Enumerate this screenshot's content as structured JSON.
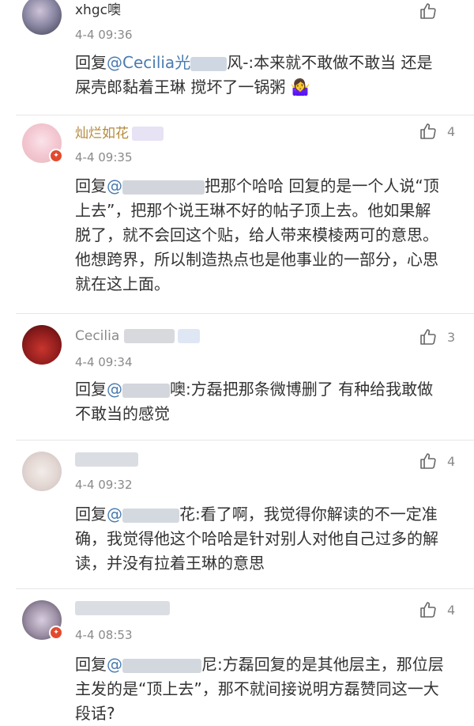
{
  "comments": [
    {
      "user": "xhgc噢",
      "time": "4-4 09:36",
      "likes": "",
      "reply_prefix": "回复",
      "mention": "@Cecilia光",
      "mention_suffix": "风-:",
      "text": "本来就不敢做不敢当 还是屎壳郎黏着王琳 搅坏了一锅粥 🤷‍♀️"
    },
    {
      "user": "灿烂如花",
      "time": "4-4 09:35",
      "likes": "4",
      "reply_prefix": "回复",
      "mention": "@",
      "mention_suffix": "把",
      "text": "那个哈哈 回复的是一个人说“顶上去”，把那个说王琳不好的帖子顶上去。他如果解脱了，就不会回这个贴，给人带来模棱两可的意思。他想跨界，所以制造热点也是他事业的一部分，心思就在这上面。"
    },
    {
      "user": "Cecilia",
      "time": "4-4 09:34",
      "likes": "3",
      "reply_prefix": "回复",
      "mention": "@",
      "mention_suffix": "噢:",
      "text": "方磊把那条微博删了 有种给我敢做不敢当的感觉"
    },
    {
      "user": "",
      "time": "4-4 09:32",
      "likes": "4",
      "reply_prefix": "回复",
      "mention": "@",
      "mention_suffix": "花:",
      "text": "看了啊，我觉得你解读的不一定准确，我觉得他这个哈哈是针对别人对他自己过多的解读，并没有拉着王琳的意思"
    },
    {
      "user": "",
      "time": "4-4 08:53",
      "likes": "4",
      "reply_prefix": "回复",
      "mention": "@",
      "mention_suffix": "尼:",
      "text": "方磊回复的是其他层主，那位层主发的是“顶上去”，那不就间接说明方磊赞同这一大段话?"
    }
  ]
}
